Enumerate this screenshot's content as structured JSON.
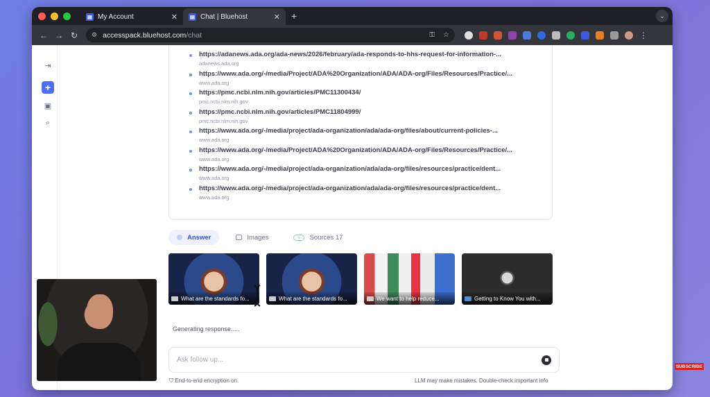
{
  "browser": {
    "tabs": [
      {
        "title": "My Account",
        "active": false
      },
      {
        "title": "Chat | Bluehost",
        "active": true
      }
    ],
    "url_host": "accesspack.bluehost.com",
    "url_path": "/chat"
  },
  "sources": [
    {
      "link": "https://adanews.ada.org/ada-news/2026/february/ada-responds-to-hhs-request-for-information-...",
      "domain": "adanews.ada.org"
    },
    {
      "link": "https://www.ada.org/-/media/Project/ADA%20Organization/ADA/ADA-org/Files/Resources/Practice/...",
      "domain": "www.ada.org"
    },
    {
      "link": "https://pmc.ncbi.nlm.nih.gov/articles/PMC11300434/",
      "domain": "pmc.ncbi.nlm.nih.gov"
    },
    {
      "link": "https://pmc.ncbi.nlm.nih.gov/articles/PMC11804999/",
      "domain": "pmc.ncbi.nlm.nih.gov"
    },
    {
      "link": "https://www.ada.org/-/media/project/ada-organization/ada/ada-org/files/about/current-policies-...",
      "domain": "www.ada.org"
    },
    {
      "link": "https://www.ada.org/-/media/Project/ADA%20Organization/ADA/ADA-org/Files/Resources/Practice/...",
      "domain": "www.ada.org"
    },
    {
      "link": "https://www.ada.org/-/media/project/ada-organization/ada/ada-org/files/resources/practice/dent...",
      "domain": "www.ada.org"
    },
    {
      "link": "https://www.ada.org/-/media/project/ada-organization/ada/ada-org/files/resources/practice/dent...",
      "domain": "www.ada.org"
    }
  ],
  "content_tabs": {
    "answer": "Answer",
    "images": "Images",
    "sources": "Sources 17"
  },
  "image_results": [
    {
      "caption": "What are the standards fo...",
      "icon": "ada-logo"
    },
    {
      "caption": "What are the standards fo...",
      "icon": "ada-logo"
    },
    {
      "caption": "We want to help reduce...",
      "icon": "ada-logo"
    },
    {
      "caption": "Getting to Know You with...",
      "icon": "site-logo"
    }
  ],
  "status_text": "Generating response.....",
  "followup": {
    "placeholder": "Ask follow up..."
  },
  "footer": {
    "encryption": "End-to-end encryption on.",
    "disclaimer": "LLM may make mistakes. Double-check important info"
  },
  "overlay": {
    "subscribe": "SUBSCRIBE"
  },
  "colors": {
    "accent": "#4f6ef7",
    "page_bg": "#7b78dc"
  }
}
